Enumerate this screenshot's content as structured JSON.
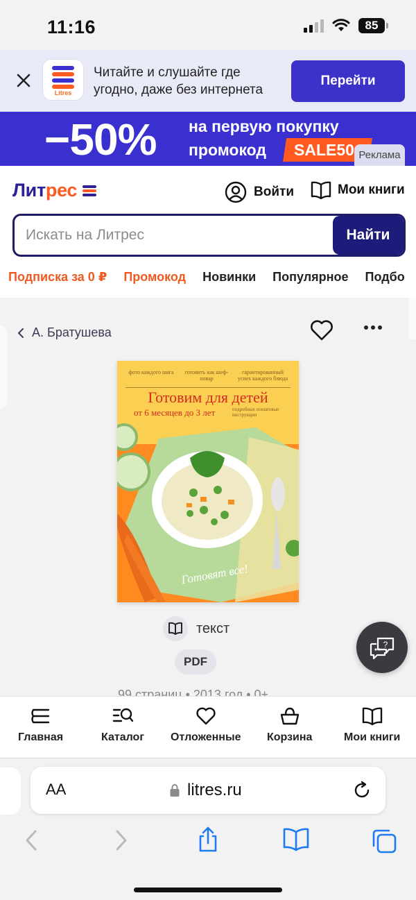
{
  "status": {
    "time": "11:16",
    "battery": "85"
  },
  "app_banner": {
    "text": "Читайте и слушайте где угодно, даже без интернета",
    "button": "Перейти",
    "logo_text": "Litres"
  },
  "promo": {
    "discount": "−50%",
    "line1": "на первую покупку",
    "line2": "промокод",
    "code": "SALE50",
    "ad_label": "Реклама"
  },
  "header": {
    "brand_part1": "Лит",
    "brand_part2": "рес",
    "login": "Войти",
    "my_books": "Мои книги",
    "search_placeholder": "Искать на Литрес",
    "search_button": "Найти"
  },
  "nav": [
    "Подписка за 0 ₽",
    "Промокод",
    "Новинки",
    "Популярное",
    "Подбо"
  ],
  "book": {
    "author": "А. Братушева",
    "cover_top1": "фото каждого шага",
    "cover_top2": "готовить как шеф-повар",
    "cover_top3": "гарантированный успех каждого блюда",
    "cover_title": "Готовим для детей",
    "cover_age": "от 6 месяцев до 3 лет",
    "cover_note": "подробные пошаговые инструкции",
    "cover_sign": "Готовят все!",
    "format": "текст",
    "file_type": "PDF",
    "meta": "99 страниц • 2013 год • 0+"
  },
  "tabbar": [
    "Главная",
    "Каталог",
    "Отложенные",
    "Корзина",
    "Мои книги"
  ],
  "safari": {
    "aa": "AA",
    "url": "litres.ru"
  },
  "colors": {
    "brand_dark": "#2c2296",
    "brand_orange": "#ff5a1f",
    "promo_bg": "#3a2fcf",
    "safari_blue": "#1f7af0"
  }
}
